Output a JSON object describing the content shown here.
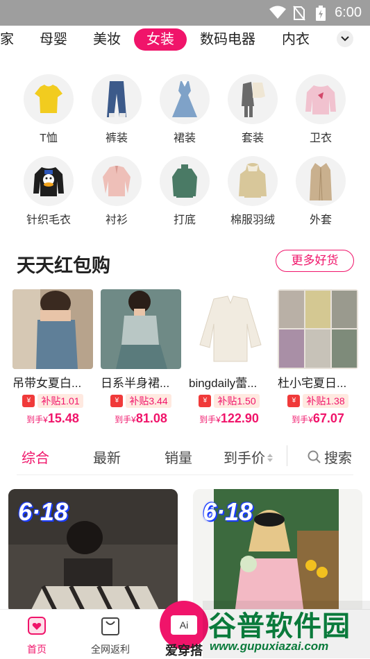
{
  "status": {
    "time": "6:00"
  },
  "category_tabs": [
    {
      "label": "家"
    },
    {
      "label": "母婴"
    },
    {
      "label": "美妆"
    },
    {
      "label": "女装",
      "active": true
    },
    {
      "label": "数码电器"
    },
    {
      "label": "内衣"
    }
  ],
  "subcategories": [
    {
      "label": "T恤",
      "icon": "yellow-tshirt"
    },
    {
      "label": "裤装",
      "icon": "jeans"
    },
    {
      "label": "裙装",
      "icon": "dress"
    },
    {
      "label": "套装",
      "icon": "suit-set"
    },
    {
      "label": "卫衣",
      "icon": "sweatshirt"
    },
    {
      "label": "针织毛衣",
      "icon": "knit-sweater"
    },
    {
      "label": "衬衫",
      "icon": "shirt"
    },
    {
      "label": "打底",
      "icon": "base-layer"
    },
    {
      "label": "棉服羽绒",
      "icon": "down-jacket"
    },
    {
      "label": "外套",
      "icon": "coat"
    }
  ],
  "promo": {
    "title": "天天红包购",
    "more_label": "更多好货",
    "products": [
      {
        "title": "吊带女夏白...",
        "subsidy": "补贴1.01",
        "price_prefix": "到手¥",
        "price": "15.48"
      },
      {
        "title": "日系半身裙...",
        "subsidy": "补贴3.44",
        "price_prefix": "到手¥",
        "price": "81.08"
      },
      {
        "title": "bingdaily蕾...",
        "subsidy": "补贴1.50",
        "price_prefix": "到手¥",
        "price": "122.90"
      },
      {
        "title": "杜小宅夏日...",
        "subsidy": "补贴1.38",
        "price_prefix": "到手¥",
        "price": "67.07"
      }
    ]
  },
  "sort": {
    "items": [
      "综合",
      "最新",
      "销量",
      "到手价"
    ],
    "search_label": "搜索"
  },
  "feed": {
    "badge": "6·18"
  },
  "bottom_nav": {
    "home": "首页",
    "rebate": "全网返利",
    "center": "爱穿搭",
    "center_icon_text": "Ai"
  },
  "watermark": {
    "line1": "谷普软件园",
    "line2": "www.gupuxiazai.com"
  },
  "colors": {
    "accent": "#f0146a",
    "statusbar": "#9e9e9e"
  }
}
